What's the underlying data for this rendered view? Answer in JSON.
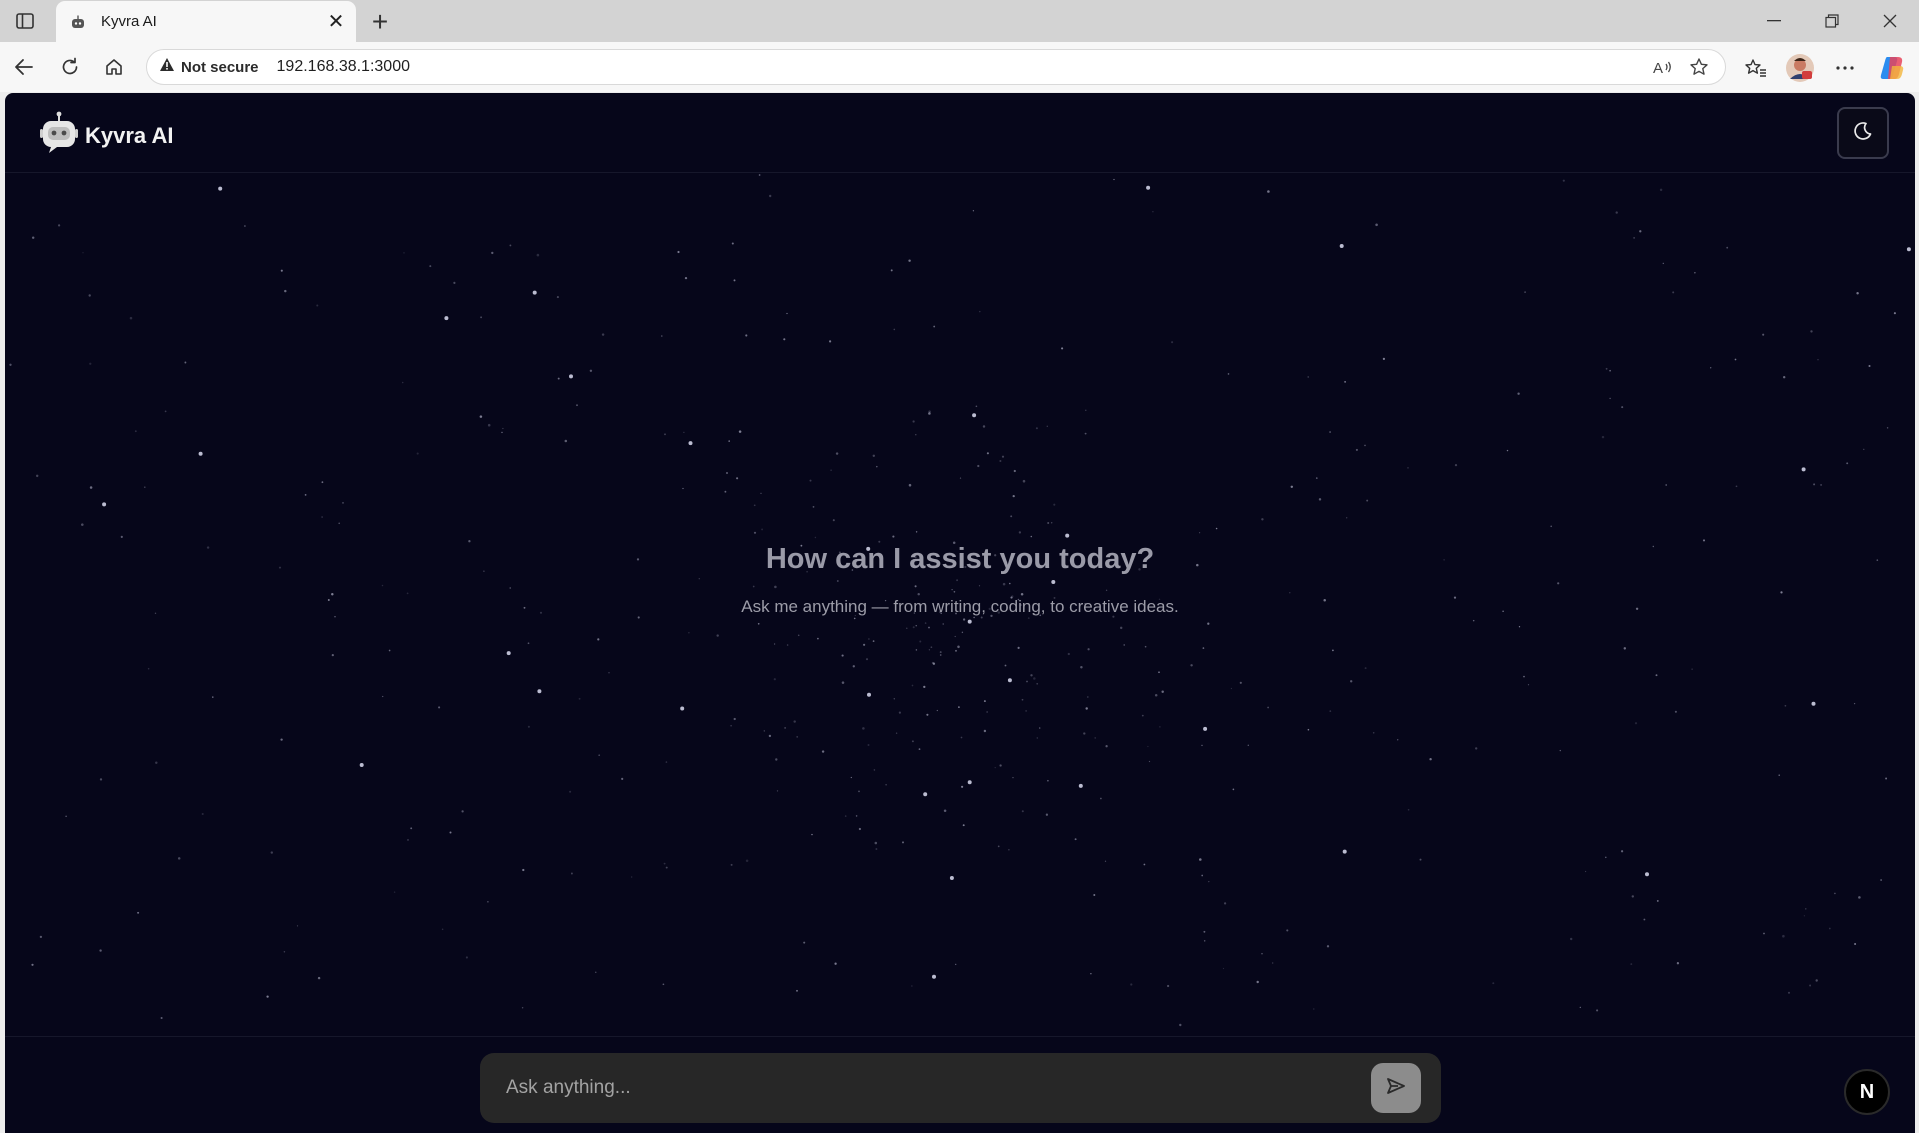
{
  "browser": {
    "tab": {
      "title": "Kyvra AI",
      "close_glyph": "✕",
      "favicon": "robot-icon"
    },
    "new_tab_glyph": "+",
    "address": {
      "security_label": "Not secure",
      "url": "192.168.38.1:3000"
    },
    "icons": [
      "sidebar-icon",
      "back-icon",
      "reload-icon",
      "home-icon",
      "read-aloud-icon",
      "favorite-star-icon",
      "favorites-icon",
      "profile-avatar",
      "more-icon",
      "copilot-icon"
    ]
  },
  "app": {
    "brand": "Kyvra AI",
    "theme_toggle_icon": "moon-icon",
    "hero": {
      "title": "How can I assist you today?",
      "subtitle": "Ask me anything — from writing, coding, to creative ideas."
    },
    "chat": {
      "placeholder": "Ask anything...",
      "send_icon": "send-icon"
    },
    "badge": "N"
  },
  "colors": {
    "background": "#06061a",
    "chat_box": "#272727",
    "send_button": "#8c8c8c",
    "text_muted": "#9a9aa8"
  }
}
